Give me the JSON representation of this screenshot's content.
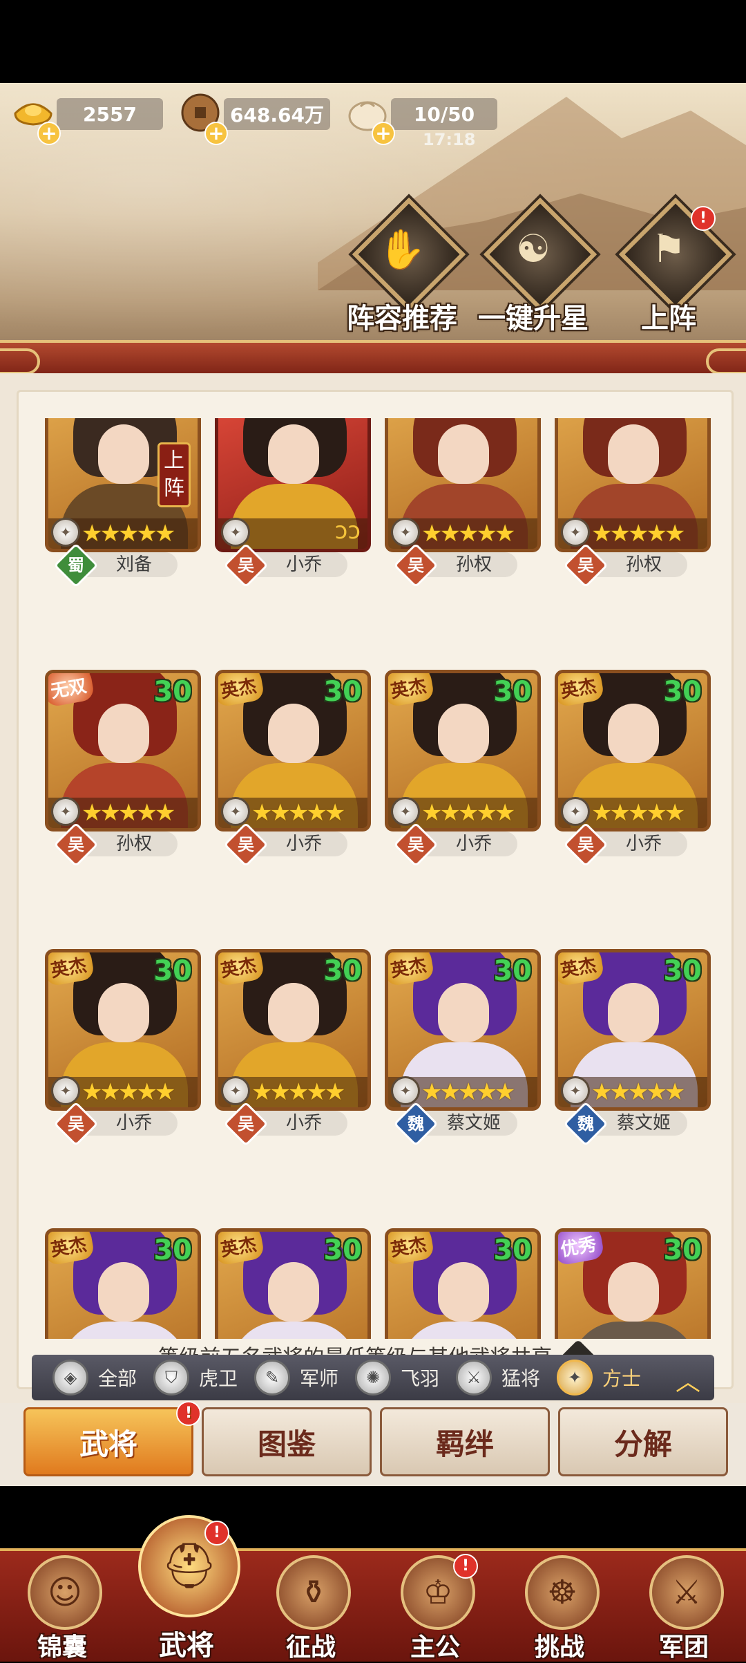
{
  "resources": [
    {
      "icon": "gold-ingot-icon",
      "value": "2557"
    },
    {
      "icon": "copper-coin-icon",
      "value": "648.64万"
    },
    {
      "icon": "bun-stamina-icon",
      "value": "10/50"
    }
  ],
  "stamina_timer": "17:18",
  "actions": [
    {
      "label": "阵容推荐",
      "glyph": "✋"
    },
    {
      "label": "一键升星",
      "glyph": "☯"
    },
    {
      "label": "上阵",
      "glyph": "⚑",
      "dot": "!"
    }
  ],
  "generals": [
    {
      "faction": "蜀",
      "faction_key": "shu",
      "name": "刘备",
      "level": "",
      "badge": "",
      "stars": "★★★★★",
      "on_field": "上阵",
      "style": "gold",
      "hair": "#3b2a20",
      "robe": "#6b4a26"
    },
    {
      "faction": "吴",
      "faction_key": "wu",
      "name": "小乔",
      "level": "",
      "badge": "",
      "stars": "",
      "on_field": "",
      "swirl": "ↄↄ",
      "style": "red",
      "hair": "#2a1c16",
      "robe": "#e2a62a"
    },
    {
      "faction": "吴",
      "faction_key": "wu",
      "name": "孙权",
      "level": "",
      "badge": "",
      "stars": "★★★★★",
      "on_field": "",
      "style": "gold",
      "hair": "#7a2a1a",
      "robe": "#a2452a"
    },
    {
      "faction": "吴",
      "faction_key": "wu",
      "name": "孙权",
      "level": "",
      "badge": "",
      "stars": "★★★★★",
      "on_field": "",
      "style": "gold",
      "hair": "#7a2a1a",
      "robe": "#a2452a"
    },
    {
      "faction": "吴",
      "faction_key": "wu",
      "name": "孙权",
      "level": "30",
      "badge": "无双",
      "badge_style": "red",
      "stars": "★★★★★",
      "on_field": "",
      "style": "gold",
      "hair": "#8a2418",
      "robe": "#b5442a"
    },
    {
      "faction": "吴",
      "faction_key": "wu",
      "name": "小乔",
      "level": "30",
      "badge": "英杰",
      "badge_style": "",
      "stars": "★★★★★",
      "on_field": "",
      "style": "gold",
      "hair": "#2a1c16",
      "robe": "#e2a62a"
    },
    {
      "faction": "吴",
      "faction_key": "wu",
      "name": "小乔",
      "level": "30",
      "badge": "英杰",
      "badge_style": "",
      "stars": "★★★★★",
      "on_field": "",
      "style": "gold",
      "hair": "#2a1c16",
      "robe": "#e2a62a"
    },
    {
      "faction": "吴",
      "faction_key": "wu",
      "name": "小乔",
      "level": "30",
      "badge": "英杰",
      "badge_style": "",
      "stars": "★★★★★",
      "on_field": "",
      "style": "gold",
      "hair": "#2a1c16",
      "robe": "#e2a62a"
    },
    {
      "faction": "吴",
      "faction_key": "wu",
      "name": "小乔",
      "level": "30",
      "badge": "英杰",
      "badge_style": "",
      "stars": "★★★★★",
      "on_field": "",
      "style": "gold",
      "hair": "#2a1c16",
      "robe": "#e2a62a"
    },
    {
      "faction": "吴",
      "faction_key": "wu",
      "name": "小乔",
      "level": "30",
      "badge": "英杰",
      "badge_style": "",
      "stars": "★★★★★",
      "on_field": "",
      "style": "gold",
      "hair": "#2a1c16",
      "robe": "#e2a62a"
    },
    {
      "faction": "魏",
      "faction_key": "wei",
      "name": "蔡文姬",
      "level": "30",
      "badge": "英杰",
      "badge_style": "",
      "stars": "★★★★★",
      "on_field": "",
      "style": "gold",
      "hair": "#5b2a9a",
      "robe": "#e9e1f0"
    },
    {
      "faction": "魏",
      "faction_key": "wei",
      "name": "蔡文姬",
      "level": "30",
      "badge": "英杰",
      "badge_style": "",
      "stars": "★★★★★",
      "on_field": "",
      "style": "gold",
      "hair": "#5b2a9a",
      "robe": "#e9e1f0"
    },
    {
      "faction": "",
      "faction_key": "",
      "name": "",
      "level": "30",
      "badge": "英杰",
      "badge_style": "",
      "stars": "",
      "on_field": "",
      "style": "gold",
      "hair": "#5b2a9a",
      "robe": "#e9e1f0"
    },
    {
      "faction": "",
      "faction_key": "",
      "name": "",
      "level": "30",
      "badge": "英杰",
      "badge_style": "",
      "stars": "",
      "on_field": "",
      "style": "gold",
      "hair": "#5b2a9a",
      "robe": "#e9e1f0"
    },
    {
      "faction": "",
      "faction_key": "",
      "name": "",
      "level": "30",
      "badge": "英杰",
      "badge_style": "",
      "stars": "",
      "on_field": "",
      "style": "gold",
      "hair": "#5b2a9a",
      "robe": "#e9e1f0"
    },
    {
      "faction": "",
      "faction_key": "",
      "name": "",
      "level": "30",
      "badge": "优秀",
      "badge_style": "purple",
      "stars": "",
      "on_field": "",
      "style": "gold",
      "hair": "#9a2a1e",
      "robe": "#6a5a4a"
    }
  ],
  "hint": "等级前五名武将的最低等级与其他武将共享",
  "filters": [
    {
      "label": "全部",
      "icon": "◈"
    },
    {
      "label": "虎卫",
      "icon": "⛉"
    },
    {
      "label": "军师",
      "icon": "✎"
    },
    {
      "label": "飞羽",
      "icon": "✺"
    },
    {
      "label": "猛将",
      "icon": "⚔"
    },
    {
      "label": "方士",
      "icon": "✦",
      "active": true
    }
  ],
  "subtabs": [
    {
      "label": "武将",
      "active": true,
      "dot": "!"
    },
    {
      "label": "图鉴"
    },
    {
      "label": "羁绊"
    },
    {
      "label": "分解"
    }
  ],
  "nav": [
    {
      "label": "锦囊",
      "icon": "☺"
    },
    {
      "label": "武将",
      "icon": "⛑",
      "active": true,
      "dot": "!"
    },
    {
      "label": "征战",
      "icon": "⚱"
    },
    {
      "label": "主公",
      "icon": "♔",
      "dot": "!"
    },
    {
      "label": "挑战",
      "icon": "☸"
    },
    {
      "label": "军团",
      "icon": "⚔"
    }
  ],
  "colors": {
    "accent": "#e07a1e",
    "nav_bg": "#8a2418",
    "level_green": "#43d155"
  }
}
